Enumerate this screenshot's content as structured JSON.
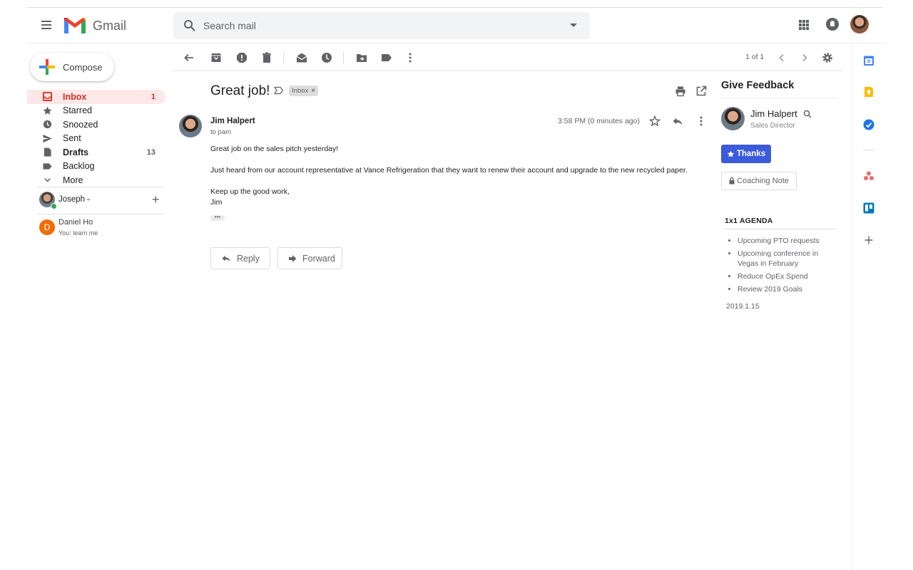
{
  "header": {
    "app_name": "Gmail",
    "search_placeholder": "Search mail"
  },
  "sidebar": {
    "compose_label": "Compose",
    "items": [
      {
        "label": "Inbox",
        "count": "1"
      },
      {
        "label": "Starred",
        "count": ""
      },
      {
        "label": "Snoozed",
        "count": ""
      },
      {
        "label": "Sent",
        "count": ""
      },
      {
        "label": "Drafts",
        "count": "13"
      },
      {
        "label": "Backlog",
        "count": ""
      },
      {
        "label": "More",
        "count": ""
      }
    ],
    "hangouts": {
      "me_name": "Joseph",
      "contact_initial": "D",
      "contact_name": "Daniel Ho",
      "contact_status": "You: learn me"
    }
  },
  "toolbar": {
    "pager": "1 of 1"
  },
  "message": {
    "subject": "Great job!",
    "label_chip": "Inbox",
    "label_close": "×",
    "sender": "Jim Halpert",
    "to": "to pam",
    "time": "3:58 PM (0 minutes ago)",
    "body": [
      "Great job on the sales pitch yesterday!",
      "Just heard from our account representative at Vance Refrigeration that they want to renew their account and upgrade to the new recycled paper.",
      "Keep up the good work,",
      "Jim"
    ],
    "ellipsis": "•••",
    "reply_label": "Reply",
    "forward_label": "Forward"
  },
  "right_panel": {
    "title": "Give Feedback",
    "person_name": "Jim Halpert",
    "person_role": "Sales Director",
    "thanks_label": "Thanks",
    "coaching_label": "Coaching Note",
    "agenda_title": "1x1 AGENDA",
    "agenda_items": [
      "Upcoming PTO requests",
      "Upcoming conference in Vegas in February",
      "Reduce OpEx Spend",
      "Review 2019 Goals"
    ],
    "agenda_date": "2019.1.15"
  },
  "colors": {
    "inbox_active_bg": "#fce8e6",
    "inbox_active_text": "#d93025",
    "thanks_button": "#3b5bdb",
    "icon_gray": "#5f6368"
  },
  "icons": {
    "header": [
      "menu-icon",
      "gmail-logo",
      "search-icon",
      "search-options-icon",
      "apps-icon",
      "notifications-icon",
      "account-avatar"
    ],
    "toolbar": [
      "back-icon",
      "archive-icon",
      "report-spam-icon",
      "delete-icon",
      "mark-unread-icon",
      "snooze-icon",
      "move-to-icon",
      "label-icon",
      "more-icon",
      "prev-icon",
      "next-icon",
      "settings-icon"
    ],
    "rail": [
      "calendar-icon",
      "keep-icon",
      "tasks-icon",
      "asana-icon",
      "trello-icon",
      "add-addon-icon"
    ]
  }
}
